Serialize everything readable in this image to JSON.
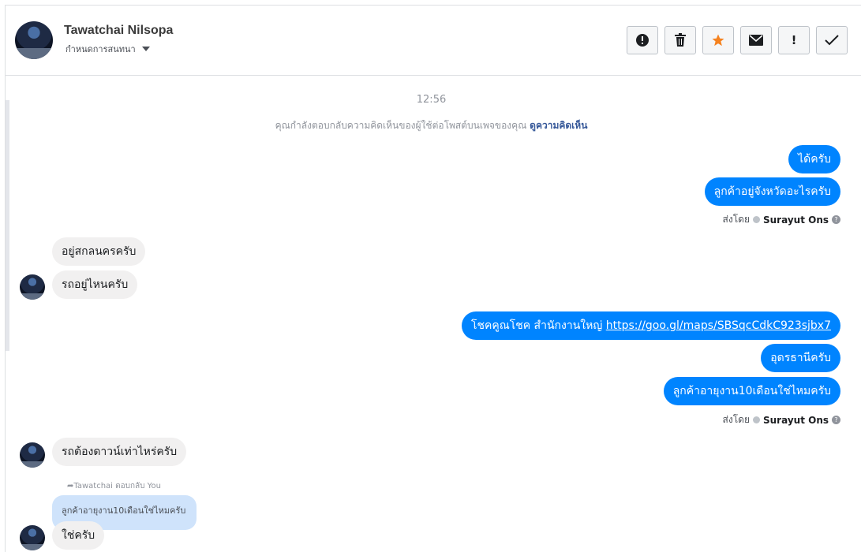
{
  "header": {
    "contact_name": "Tawatchai Nilsopa",
    "conversation_setting": "กำหนดการสนทนา",
    "toolbar": [
      {
        "name": "report-button",
        "icon": "alert-circle-icon",
        "glyph": "❗"
      },
      {
        "name": "delete-button",
        "icon": "trash-icon",
        "glyph": "🗑"
      },
      {
        "name": "star-button",
        "icon": "star-icon",
        "glyph": "★"
      },
      {
        "name": "mail-button",
        "icon": "envelope-icon",
        "glyph": "✉"
      },
      {
        "name": "important-button",
        "icon": "exclamation-icon",
        "glyph": "!"
      },
      {
        "name": "done-button",
        "icon": "check-icon",
        "glyph": "✓"
      }
    ]
  },
  "chat": {
    "timestamp": "12:56",
    "system_note": "คุณกำลังตอบกลับความคิดเห็นของผู้ใช้ต่อโพสต์บนเพจของคุณ",
    "system_note_link": "ดูความคิดเห็น",
    "out_group_1": [
      "ได้ครับ",
      "ลูกค้าอยู่จังหวัดอะไรครับ"
    ],
    "sent_by_label": "ส่งโดย",
    "sent_by_name": "Surayut Ons",
    "in_group_1": [
      "อยู่สกลนครครับ",
      "รถอยู่ไหนครับ"
    ],
    "out_group_2_prefix": "โชคคูณโชค สำนักงานใหญ่ ",
    "out_group_2_link": "https://goo.gl/maps/SBSqcCdkC923sjbx7",
    "out_group_2": [
      "อุดรธานีครับ",
      "ลูกค้าอายุงาน10เดือนใช่ไหมครับ"
    ],
    "in_group_2": [
      "รถต้องดาวน์เท่าไหร่ครับ"
    ],
    "reply_note": "Tawatchai ตอบกลับ You",
    "quoted_text": "ลูกค้าอายุงาน10เดือนใช่ไหมครับ",
    "in_group_3": [
      "ใช่ครับ"
    ]
  },
  "colors": {
    "outgoing_bubble": "#0084ff",
    "incoming_bubble": "#f1f0f0",
    "quoted_bubble": "#cfe3fb",
    "star": "#f5821f"
  }
}
